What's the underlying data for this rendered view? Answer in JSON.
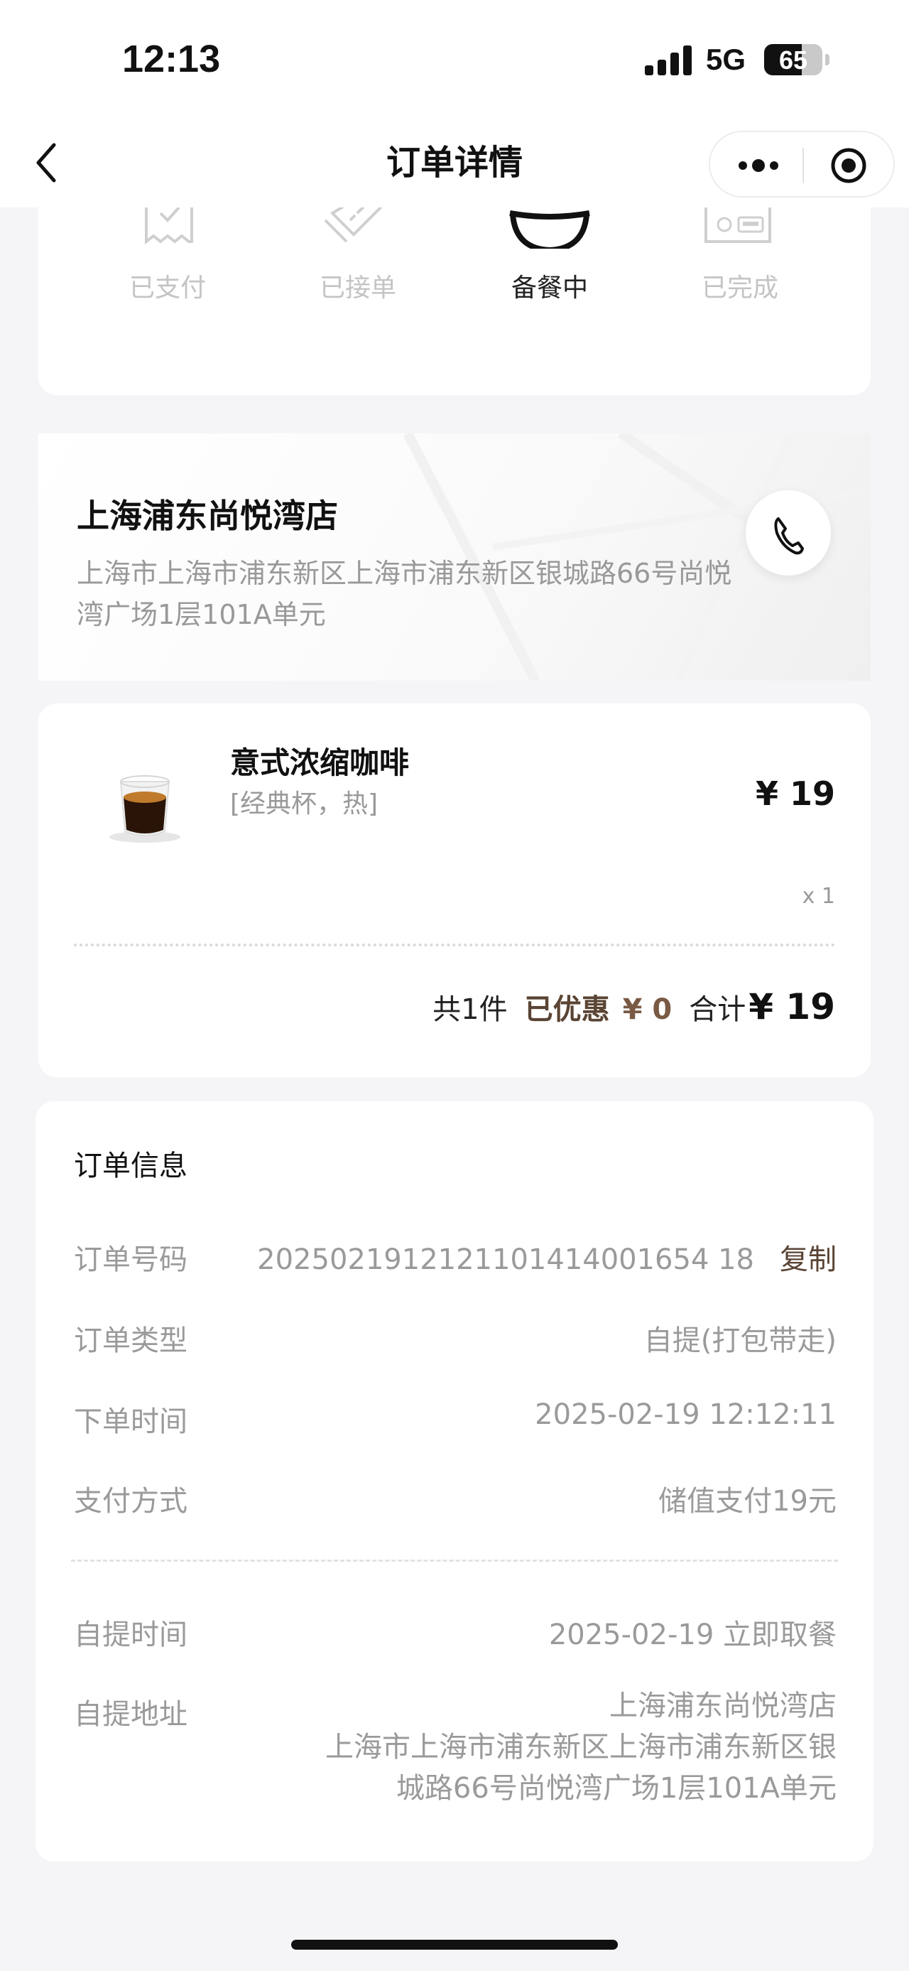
{
  "status_bar": {
    "time": "12:13",
    "network": "5G",
    "battery": "65",
    "battery_level": 0.65
  },
  "nav": {
    "title": "订单详情"
  },
  "progress": {
    "steps": [
      {
        "label": "已支付",
        "state": "done"
      },
      {
        "label": "已接单",
        "state": "done"
      },
      {
        "label": "备餐中",
        "state": "active"
      },
      {
        "label": "已完成",
        "state": "pending"
      }
    ]
  },
  "store": {
    "name": "上海浦东尚悦湾店",
    "address_line1": "上海市上海市浦东新区上海市浦东新区银城路66号尚悦",
    "address_line2": "湾广场1层101A单元"
  },
  "order_item": {
    "name": "意式浓缩咖啡",
    "spec": "[经典杯，热]",
    "price": "¥ 19",
    "qty": "x 1"
  },
  "summary": {
    "count": "共1件",
    "discount_label": "已优惠",
    "discount_value": "¥ 0",
    "total_label": "合计",
    "total_value": "¥ 19"
  },
  "order_info": {
    "title": "订单信息",
    "order_no_label": "订单号码",
    "order_no": "2025021912121101414001654 18",
    "copy_label": "复制",
    "type_label": "订单类型",
    "type_value": "自提(打包带走)",
    "time_label": "下单时间",
    "time_value": "2025-02-19 12:12:11",
    "pay_label": "支付方式",
    "pay_value": "储值支付19元",
    "pickup_time_label": "自提时间",
    "pickup_time_value": "2025-02-19 立即取餐",
    "pickup_addr_label": "自提地址",
    "pickup_addr_line1": "上海浦东尚悦湾店",
    "pickup_addr_line2": "上海市上海市浦东新区上海市浦东新区银",
    "pickup_addr_line3": "城路66号尚悦湾广场1层101A单元"
  },
  "colors": {
    "accent_brown": "#5a4434",
    "muted_text": "#9a9a9a",
    "background": "#f5f5f7"
  },
  "icons": [
    "back-icon",
    "more-icon",
    "target-icon",
    "receipt-icon",
    "tickets-icon",
    "bowl-icon",
    "card-icon",
    "phone-icon"
  ]
}
